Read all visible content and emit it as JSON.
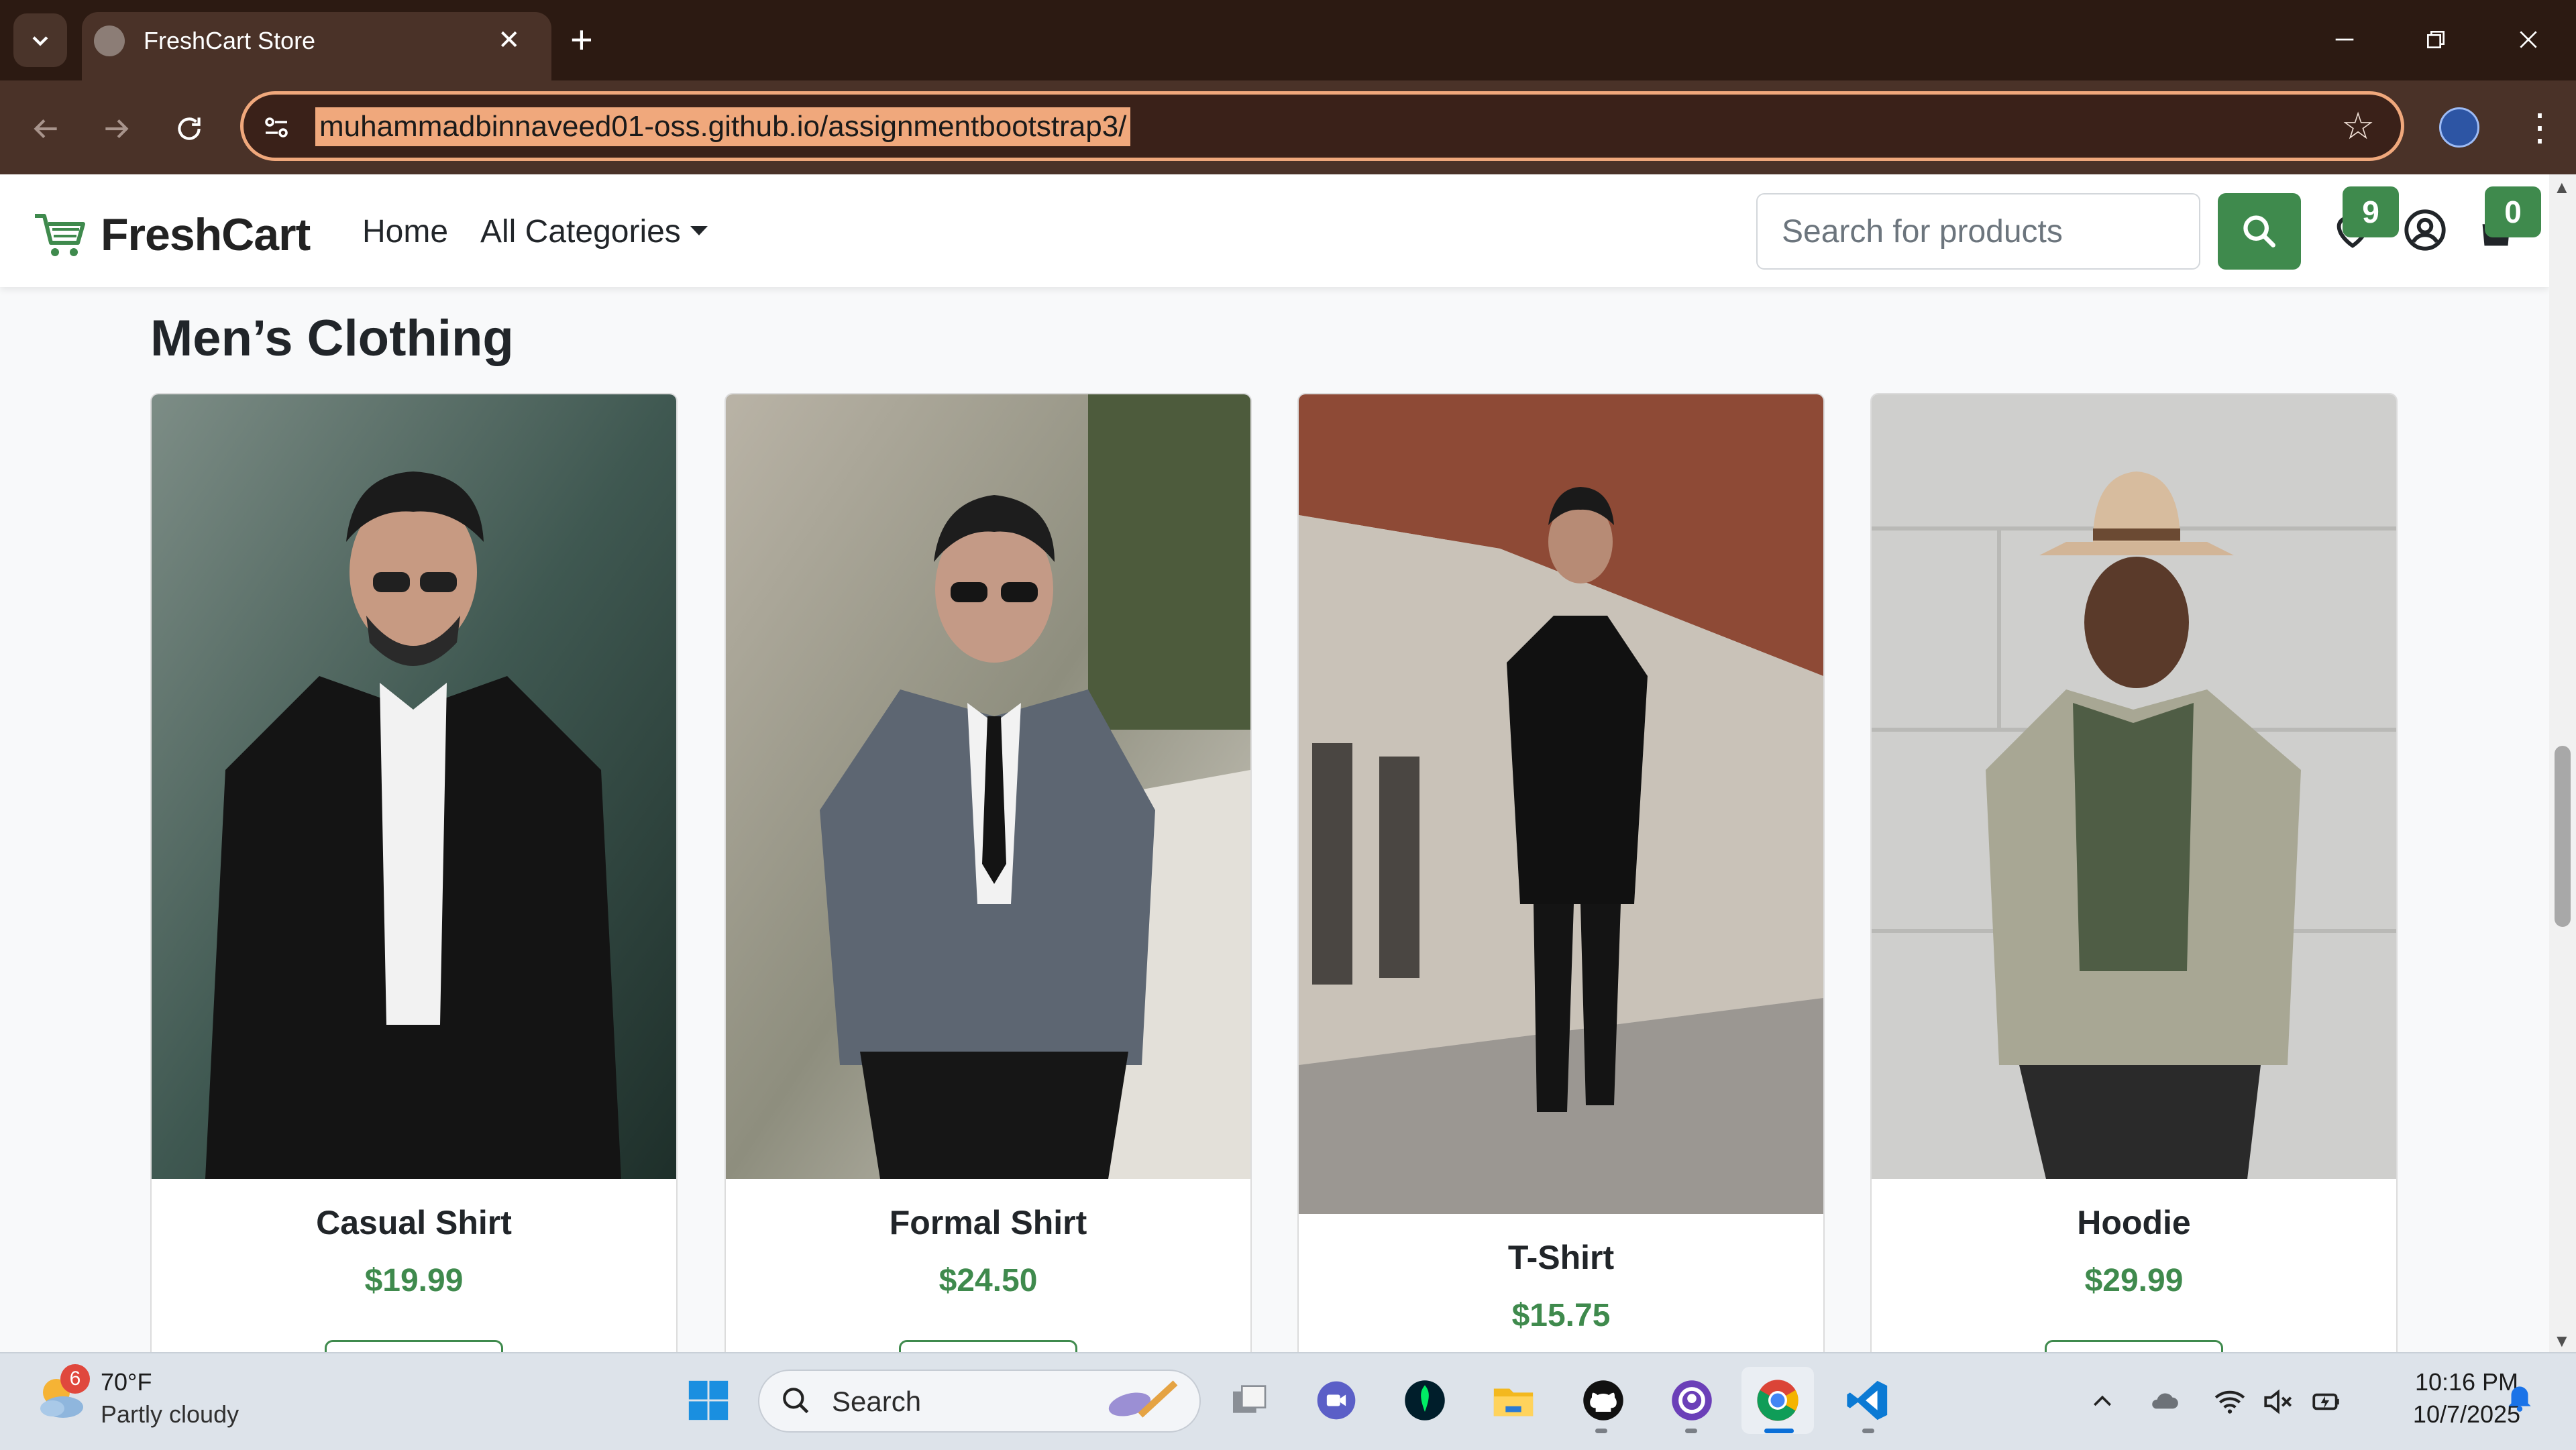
{
  "browser": {
    "tab_title": "FreshCart Store",
    "url": "muhammadbinnaveed01-oss.github.io/assignmentbootstrap3/"
  },
  "site": {
    "brand": "FreshCart",
    "nav": {
      "home": "Home",
      "categories": "All Categories"
    },
    "search_placeholder": "Search for products",
    "wishlist_count": "9",
    "cart_count": "0",
    "accent_color": "#3f8a4d"
  },
  "section": {
    "title": "Men’s Clothing"
  },
  "products": [
    {
      "name": "Casual Shirt",
      "price": "$19.99"
    },
    {
      "name": "Formal Shirt",
      "price": "$24.50"
    },
    {
      "name": "T-Shirt",
      "price": "$15.75"
    },
    {
      "name": "Hoodie",
      "price": "$29.99"
    }
  ],
  "taskbar": {
    "weather_badge": "6",
    "temperature": "70°F",
    "condition": "Partly cloudy",
    "search_label": "Search",
    "time": "10:16 PM",
    "date": "10/7/2025"
  }
}
